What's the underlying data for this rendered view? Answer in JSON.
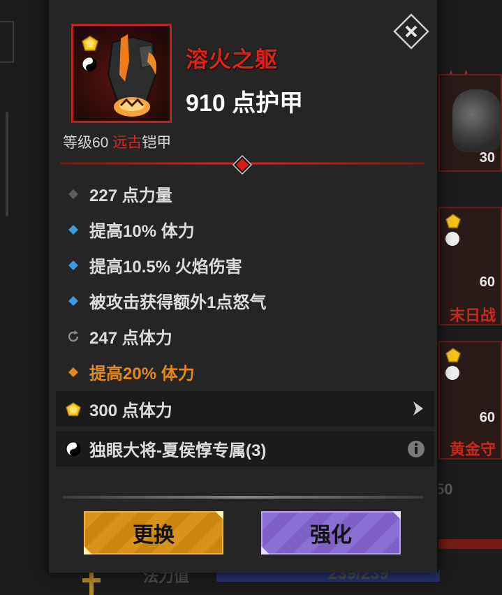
{
  "item": {
    "name": "溶火之躯",
    "armor": "910 点护甲",
    "level_prefix": "等级60 ",
    "quality": "远古",
    "type": "铠甲"
  },
  "stats": [
    {
      "icon": "grey-diamond-icon",
      "text": "227 点力量"
    },
    {
      "icon": "blue-diamond-icon",
      "text": "提高10% 体力"
    },
    {
      "icon": "blue-diamond-icon",
      "text": "提高10.5% 火焰伤害"
    },
    {
      "icon": "blue-diamond-icon",
      "text": "被攻击获得额外1点怒气"
    },
    {
      "icon": "reroll-icon",
      "text": "247 点体力"
    },
    {
      "icon": "orange-diamond-icon",
      "text": "提高20% 体力"
    },
    {
      "icon": "gem-icon",
      "text": "300 点体力"
    },
    {
      "icon": "yin-yang-icon",
      "text": "独眼大将-夏侯惇专属(3)"
    }
  ],
  "buttons": {
    "replace": "更换",
    "upgrade": "强化"
  },
  "background": {
    "card1_level": "30",
    "card2_level": "60",
    "card2_name": "末日战",
    "card3_level": "60",
    "card3_name": "黄金守",
    "right_number": "50",
    "bottom_label": "法力值",
    "bottom_value": "239/239"
  },
  "colors": {
    "legendary_red": "#e0211a",
    "gold": "#d8921a",
    "purple": "#8c6fd4",
    "set_orange": "#e5871f"
  }
}
